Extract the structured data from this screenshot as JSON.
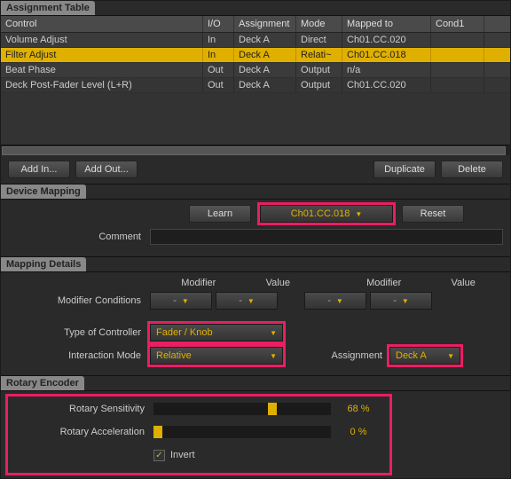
{
  "assignment_table": {
    "title": "Assignment Table",
    "headers": {
      "control": "Control",
      "io": "I/O",
      "assignment": "Assignment",
      "mode": "Mode",
      "mapped_to": "Mapped to",
      "cond1": "Cond1"
    },
    "rows": [
      {
        "control": "Volume Adjust",
        "io": "In",
        "assignment": "Deck A",
        "mode": "Direct",
        "mapped_to": "Ch01.CC.020",
        "cond1": "",
        "selected": false
      },
      {
        "control": "Filter Adjust",
        "io": "In",
        "assignment": "Deck A",
        "mode": "Relati~",
        "mapped_to": "Ch01.CC.018",
        "cond1": "",
        "selected": true
      },
      {
        "control": "Beat Phase",
        "io": "Out",
        "assignment": "Deck A",
        "mode": "Output",
        "mapped_to": "n/a",
        "cond1": "",
        "selected": false
      },
      {
        "control": "Deck Post-Fader Level (L+R)",
        "io": "Out",
        "assignment": "Deck A",
        "mode": "Output",
        "mapped_to": "Ch01.CC.020",
        "cond1": "",
        "selected": false
      }
    ],
    "buttons": {
      "add_in": "Add In...",
      "add_out": "Add Out...",
      "duplicate": "Duplicate",
      "delete": "Delete"
    }
  },
  "device_mapping": {
    "title": "Device Mapping",
    "learn": "Learn",
    "midi_value": "Ch01.CC.018",
    "reset": "Reset",
    "comment_label": "Comment",
    "comment_value": ""
  },
  "mapping_details": {
    "title": "Mapping Details",
    "col_modifier": "Modifier",
    "col_value": "Value",
    "modifier_conditions_label": "Modifier Conditions",
    "mod_dash": "-",
    "type_label": "Type of Controller",
    "type_value": "Fader / Knob",
    "interaction_label": "Interaction Mode",
    "interaction_value": "Relative",
    "assignment_label": "Assignment",
    "assignment_value": "Deck A"
  },
  "rotary_encoder": {
    "title": "Rotary Encoder",
    "sensitivity_label": "Rotary Sensitivity",
    "sensitivity_value": "68 %",
    "sensitivity_pct": 68,
    "acceleration_label": "Rotary Acceleration",
    "acceleration_value": "0 %",
    "acceleration_pct": 0,
    "invert_label": "Invert",
    "invert_checked": true
  }
}
